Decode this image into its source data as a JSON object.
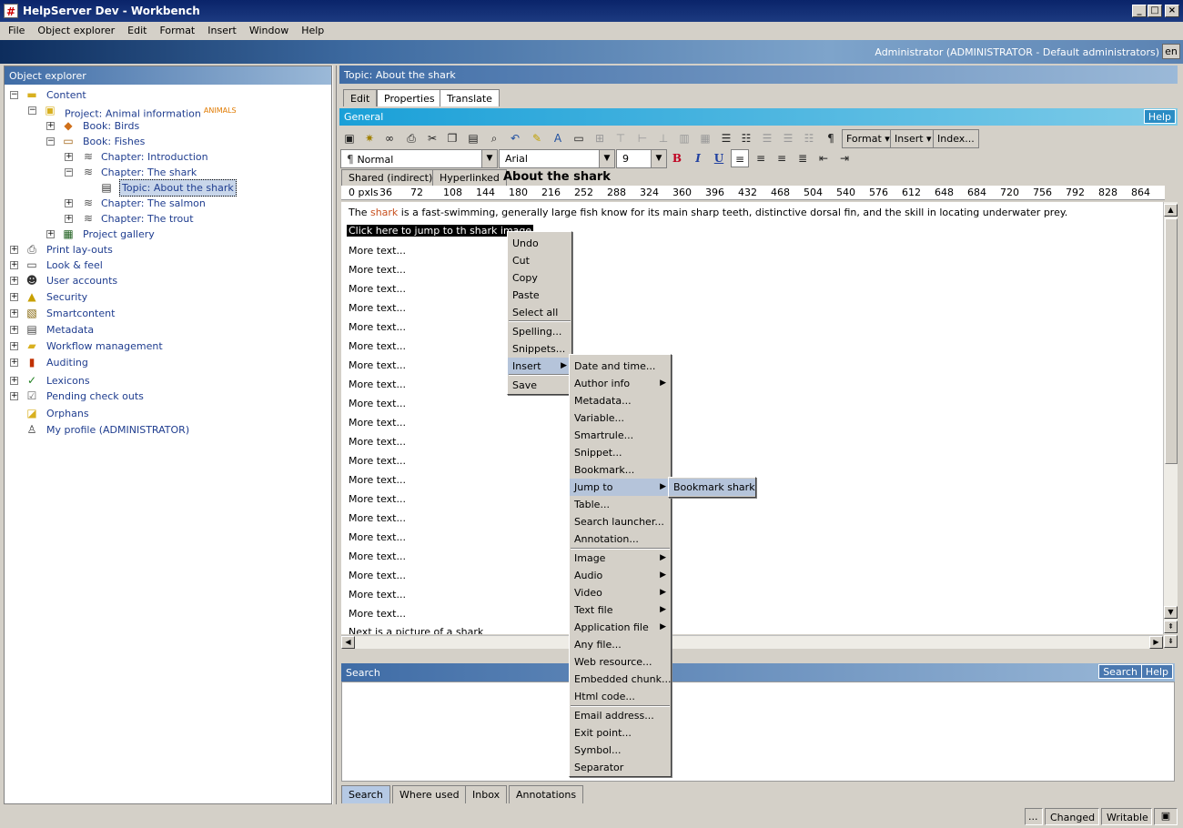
{
  "window": {
    "title": "HelpServer Dev - Workbench",
    "app_icon": "#"
  },
  "menubar": [
    "File",
    "Object explorer",
    "Edit",
    "Format",
    "Insert",
    "Window",
    "Help"
  ],
  "banner": {
    "user": "Administrator (ADMINISTRATOR - Default administrators)",
    "lang": "en"
  },
  "explorer": {
    "title": "Object explorer",
    "items": [
      {
        "label": "Content"
      },
      {
        "label": "Project: Animal information",
        "tag": "ANIMALS"
      },
      {
        "label": "Book: Birds"
      },
      {
        "label": "Book: Fishes"
      },
      {
        "label": "Chapter: Introduction"
      },
      {
        "label": "Chapter: The shark"
      },
      {
        "label": "Topic: About the shark"
      },
      {
        "label": "Chapter: The salmon"
      },
      {
        "label": "Chapter: The trout"
      },
      {
        "label": "Project gallery"
      },
      {
        "label": "Print lay-outs"
      },
      {
        "label": "Look & feel"
      },
      {
        "label": "User accounts"
      },
      {
        "label": "Security"
      },
      {
        "label": "Smartcontent"
      },
      {
        "label": "Metadata"
      },
      {
        "label": "Workflow management"
      },
      {
        "label": "Auditing"
      },
      {
        "label": "Lexicons"
      },
      {
        "label": "Pending check outs"
      },
      {
        "label": "Orphans"
      },
      {
        "label": "My profile (ADMINISTRATOR)"
      }
    ]
  },
  "topic": {
    "title": "Topic: About the shark",
    "tabs": [
      "Edit",
      "Properties",
      "Translate"
    ]
  },
  "general": {
    "title": "General",
    "help": "Help"
  },
  "toolbar": {
    "format": "Format",
    "insert": "Insert",
    "index": "Index..."
  },
  "formatbar": {
    "style": "Normal",
    "font": "Arial",
    "size": "9",
    "bold": "B",
    "italic": "I",
    "underline": "U"
  },
  "subtabs": [
    "Shared (indirect)",
    "Hyperlinked"
  ],
  "heading": "About the shark",
  "ruler": [
    "0 pxls",
    "36",
    "72",
    "108",
    "144",
    "180",
    "216",
    "252",
    "288",
    "324",
    "360",
    "396",
    "432",
    "468",
    "504",
    "540",
    "576",
    "612",
    "648",
    "684",
    "720",
    "756",
    "792",
    "828",
    "864"
  ],
  "editor": {
    "first_pre": "The ",
    "first_link": "shark",
    "first_post": " is a fast-swimming, generally large fish know for its main sharp teeth, distinctive dorsal fin, and the skill in locating underwater prey.",
    "selected": "Click here to jump to th shark image",
    "more": "More text...",
    "last": "Next is a picture of a shark"
  },
  "context_menu": [
    "Undo",
    "Cut",
    "Copy",
    "Paste",
    "Select all",
    "Spelling...",
    "Snippets...",
    "Insert",
    "Save"
  ],
  "insert_menu": [
    "Date and time...",
    "Author info",
    "Metadata...",
    "Variable...",
    "Smartrule...",
    "Snippet...",
    "Bookmark...",
    "Jump to",
    "Table...",
    "Search launcher...",
    "Annotation...",
    "Image",
    "Audio",
    "Video",
    "Text file",
    "Application file",
    "Any file...",
    "Web resource...",
    "Embedded chunk...",
    "Html code...",
    "Email address...",
    "Exit point...",
    "Symbol...",
    "Separator"
  ],
  "jump_menu": [
    "Bookmark shark"
  ],
  "search": {
    "title": "Search",
    "button": "Search",
    "help": "Help"
  },
  "bottom_tabs": [
    "Search",
    "Where used",
    "Inbox",
    "Annotations"
  ],
  "status": {
    "dots": "...",
    "changed": "Changed",
    "writable": "Writable"
  },
  "colors": {
    "link": "#c8501e",
    "tag": "#e07a00",
    "accent": "#1aa0d8"
  }
}
